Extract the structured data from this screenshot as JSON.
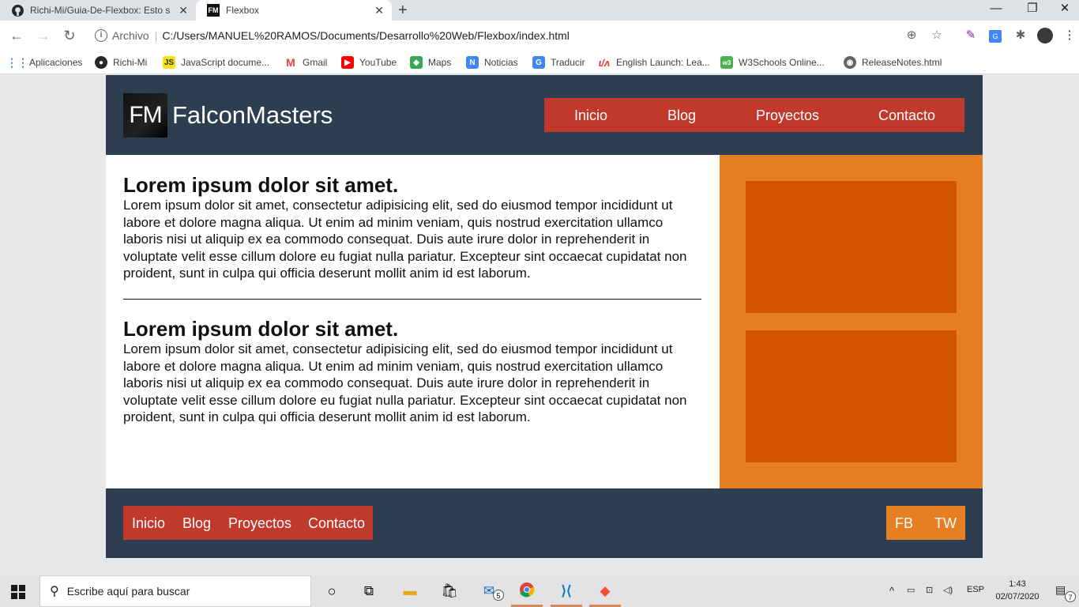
{
  "browser": {
    "tabs": [
      {
        "title": "Richi-Mi/Guia-De-Flexbox: Esto s",
        "icon": "github-icon"
      },
      {
        "title": "Flexbox",
        "icon": "fm-favicon",
        "active": true
      }
    ],
    "new_tab": "+",
    "address": {
      "security_label": "Archivo",
      "url": "C:/Users/MANUEL%20RAMOS/Documents/Desarrollo%20Web/Flexbox/index.html"
    },
    "bookmarks": [
      {
        "label": "Aplicaciones",
        "icon": "apps-grid-icon",
        "color": "#4285f4"
      },
      {
        "label": "Richi-Mi",
        "icon": "github-icon",
        "color": "#24292e"
      },
      {
        "label": "JavaScript docume...",
        "icon": "mdn-icon",
        "color": "#83d0f2"
      },
      {
        "label": "Gmail",
        "icon": "gmail-icon",
        "color": "#ea4335"
      },
      {
        "label": "YouTube",
        "icon": "youtube-icon",
        "color": "#ff0000"
      },
      {
        "label": "Maps",
        "icon": "maps-icon",
        "color": "#34a853"
      },
      {
        "label": "Noticias",
        "icon": "news-icon",
        "color": "#4285f4"
      },
      {
        "label": "Traducir",
        "icon": "translate-icon",
        "color": "#4285f4"
      },
      {
        "label": "English Launch: Lea...",
        "icon": "english-launch-icon",
        "color": "#e53935"
      },
      {
        "label": "W3Schools Online...",
        "icon": "w3schools-icon",
        "color": "#4caf50"
      },
      {
        "label": "ReleaseNotes.html",
        "icon": "globe-icon",
        "color": "#5f6368"
      }
    ]
  },
  "site": {
    "logo_mark": "FM",
    "logo_text": "FalconMasters",
    "nav": [
      "Inicio",
      "Blog",
      "Proyectos",
      "Contacto"
    ],
    "articles": [
      {
        "title": "Lorem ipsum dolor sit amet.",
        "body": "Lorem ipsum dolor sit amet, consectetur adipisicing elit, sed do eiusmod tempor incididunt ut labore et dolore magna aliqua. Ut enim ad minim veniam, quis nostrud exercitation ullamco laboris nisi ut aliquip ex ea commodo consequat. Duis aute irure dolor in reprehenderit in voluptate velit esse cillum dolore eu fugiat nulla pariatur. Excepteur sint occaecat cupidatat non proident, sunt in culpa qui officia deserunt mollit anim id est laborum."
      },
      {
        "title": "Lorem ipsum dolor sit amet.",
        "body": "Lorem ipsum dolor sit amet, consectetur adipisicing elit, sed do eiusmod tempor incididunt ut labore et dolore magna aliqua. Ut enim ad minim veniam, quis nostrud exercitation ullamco laboris nisi ut aliquip ex ea commodo consequat. Duis aute irure dolor in reprehenderit in voluptate velit esse cillum dolore eu fugiat nulla pariatur. Excepteur sint occaecat cupidatat non proident, sunt in culpa qui officia deserunt mollit anim id est laborum."
      }
    ],
    "footer_nav": [
      "Inicio",
      "Blog",
      "Proyectos",
      "Contacto"
    ],
    "social": [
      "FB",
      "TW"
    ],
    "colors": {
      "header": "#2c3e50",
      "nav": "#c0392b",
      "aside": "#e67e22",
      "box": "#d35400"
    }
  },
  "taskbar": {
    "search_placeholder": "Escribe aquí para buscar",
    "mail_badge": "5",
    "language": "ESP",
    "time": "1:43",
    "date": "02/07/2020",
    "notifications": "7"
  }
}
